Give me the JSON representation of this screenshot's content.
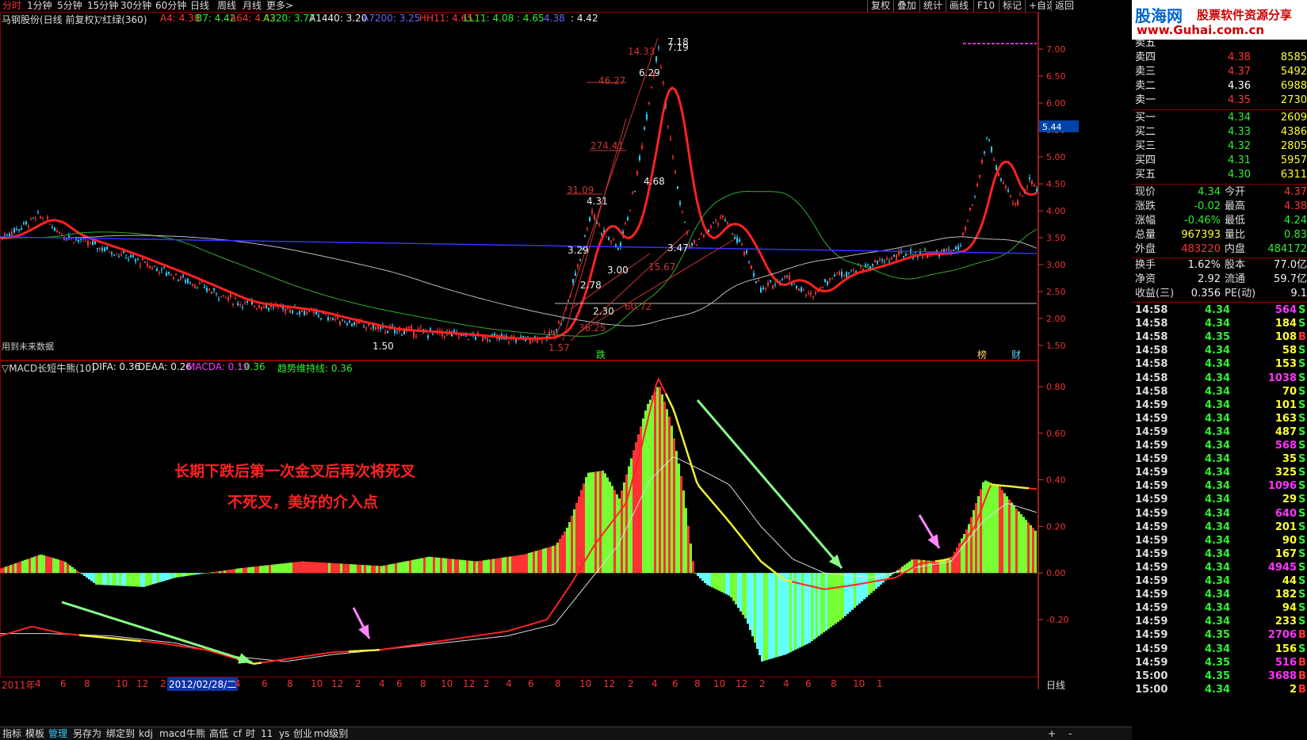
{
  "toolbar": {
    "left_items": [
      "分时",
      "1分钟",
      "5分钟",
      "15分钟",
      "30分钟",
      "60分钟",
      "日线",
      "周线",
      "月线",
      "更多>"
    ],
    "active_index": 0,
    "right_items": [
      "复权",
      "叠加",
      "统计",
      "画线",
      "F10",
      "标记",
      "+自选",
      "返回"
    ]
  },
  "main_indicator": {
    "title": "马钢股份(日线 前复权)",
    "ma_name": "▽红绿(360)",
    "items": [
      {
        "text": "A4: 4.38",
        "color": "#f33"
      },
      {
        "text": "B7: 4.42",
        "color": "#3e3"
      },
      {
        "text": "A64: 4.42",
        "color": "#f33"
      },
      {
        "text": "A320: 3.77",
        "color": "#3e3"
      },
      {
        "text": "A1440: 3.20",
        "color": "#eee"
      },
      {
        "text": "A7200: 3.25",
        "color": "#66f"
      },
      {
        "text": "HH11: 4.65",
        "color": "#f33"
      },
      {
        "text": "LL11: 4.08 : 4.65",
        "color": "#3e3"
      },
      {
        "text": "4.38",
        "color": "#66f"
      },
      {
        "text": ": 4.42",
        "color": "#eee"
      }
    ]
  },
  "sub_indicator": {
    "title": "▽MACD长短牛熊(10)",
    "items": [
      {
        "text": "DIFA: 0.36",
        "color": "#eee"
      },
      {
        "text": "DEAA: 0.26",
        "color": "#eee"
      },
      {
        "text": "MACDA: 0.19",
        "color": "#f3f"
      },
      {
        "text": ": 0.36",
        "color": "#3e3"
      },
      {
        "text": "趋势维持线: 0.36",
        "color": "#3e3"
      }
    ]
  },
  "price_axis": [
    "7.00",
    "6.50",
    "6.00",
    "5.50",
    "5.00",
    "4.50",
    "4.00",
    "3.50",
    "3.00",
    "2.50",
    "2.00",
    "1.50"
  ],
  "price_current": "5.44",
  "macd_axis": [
    "0.80",
    "0.60",
    "0.40",
    "0.20",
    "0.00",
    "-0.20"
  ],
  "price_annotations": [
    "7.18",
    "7.19",
    "14.33",
    "46.27",
    "6.29",
    "274.41",
    "31.09",
    "4.31",
    "4.68",
    "3.47",
    "3.29",
    "3.00",
    "2.78",
    "15.67",
    "60.72",
    "2.30",
    "1.50",
    "1.57",
    "36.25"
  ],
  "future_data_note": "用到未来数据",
  "marks": [
    "跌",
    "榜",
    "财"
  ],
  "annotation_line1": "长期下跌后第一次金叉后再次将死叉",
  "annotation_line2": "不死叉，美好的介入点",
  "xaxis": {
    "year": "2011年",
    "date_box": "2012/02/28/二",
    "right_label": "日线",
    "ticks": [
      "4",
      "6",
      "8",
      "10",
      "12",
      "2",
      "4",
      "6",
      "8",
      "10",
      "12",
      "2",
      "4",
      "6",
      "8",
      "10",
      "12",
      "2",
      "4",
      "6",
      "8",
      "10",
      "12",
      "2",
      "4",
      "6",
      "8",
      "10",
      "12",
      "2",
      "4",
      "6",
      "8",
      "10",
      "1"
    ]
  },
  "bottom_bar": [
    "指标",
    "模板",
    "管理",
    "另存为",
    "绑定到",
    "kdj",
    "macd",
    "牛熊",
    "高低",
    "cf",
    "时",
    "11",
    "ys",
    "创业",
    "md级别"
  ],
  "bottom_active_index": 2,
  "bottom_right": [
    "+",
    "-"
  ],
  "logo": {
    "title": "股海网",
    "subtitle": "股票软件资源分享",
    "url": "www.Guhai.com.cn"
  },
  "quote": {
    "sell": [
      {
        "label": "卖五",
        "price": "",
        "vol": ""
      },
      {
        "label": "卖四",
        "price": "4.38",
        "vol": "8585"
      },
      {
        "label": "卖三",
        "price": "4.37",
        "vol": "5492"
      },
      {
        "label": "卖二",
        "price": "4.36",
        "vol": "6988"
      },
      {
        "label": "卖一",
        "price": "4.35",
        "vol": "2730"
      }
    ],
    "buy": [
      {
        "label": "买一",
        "price": "4.34",
        "vol": "2609"
      },
      {
        "label": "买二",
        "price": "4.33",
        "vol": "4386"
      },
      {
        "label": "买三",
        "price": "4.32",
        "vol": "2805"
      },
      {
        "label": "买四",
        "price": "4.31",
        "vol": "5957"
      },
      {
        "label": "买五",
        "price": "4.30",
        "vol": "6311"
      }
    ],
    "stats": [
      {
        "l1": "现价",
        "v1": "4.34",
        "c1": "green",
        "l2": "今开",
        "v2": "4.37",
        "c2": "red"
      },
      {
        "l1": "涨跌",
        "v1": "-0.02",
        "c1": "green",
        "l2": "最高",
        "v2": "4.38",
        "c2": "red"
      },
      {
        "l1": "涨幅",
        "v1": "-0.46%",
        "c1": "green",
        "l2": "最低",
        "v2": "4.24",
        "c2": "green"
      },
      {
        "l1": "总量",
        "v1": "967393",
        "c1": "yellow",
        "l2": "量比",
        "v2": "0.83",
        "c2": "green"
      },
      {
        "l1": "外盘",
        "v1": "483220",
        "c1": "red",
        "l2": "内盘",
        "v2": "484172",
        "c2": "green"
      },
      {
        "l1": "换手",
        "v1": "1.62%",
        "c1": "white",
        "l2": "股本",
        "v2": "77.0亿",
        "c2": "white"
      },
      {
        "l1": "净资",
        "v1": "2.92",
        "c1": "white",
        "l2": "流通",
        "v2": "59.7亿",
        "c2": "white"
      },
      {
        "l1": "收益(三)",
        "v1": "0.356",
        "c1": "white",
        "l2": "PE(动)",
        "v2": "9.1",
        "c2": "white"
      }
    ],
    "ticks": [
      {
        "t": "14:58",
        "p": "4.34",
        "v": "564",
        "s": "S",
        "vc": "magenta"
      },
      {
        "t": "14:58",
        "p": "4.34",
        "v": "184",
        "s": "S",
        "vc": "yellow"
      },
      {
        "t": "14:58",
        "p": "4.35",
        "v": "108",
        "s": "B",
        "vc": "yellow"
      },
      {
        "t": "14:58",
        "p": "4.34",
        "v": "58",
        "s": "S",
        "vc": "yellow"
      },
      {
        "t": "14:58",
        "p": "4.34",
        "v": "153",
        "s": "S",
        "vc": "yellow"
      },
      {
        "t": "14:58",
        "p": "4.34",
        "v": "1038",
        "s": "S",
        "vc": "magenta"
      },
      {
        "t": "14:58",
        "p": "4.34",
        "v": "70",
        "s": "S",
        "vc": "yellow"
      },
      {
        "t": "14:59",
        "p": "4.34",
        "v": "101",
        "s": "S",
        "vc": "yellow"
      },
      {
        "t": "14:59",
        "p": "4.34",
        "v": "163",
        "s": "S",
        "vc": "yellow"
      },
      {
        "t": "14:59",
        "p": "4.34",
        "v": "487",
        "s": "S",
        "vc": "yellow"
      },
      {
        "t": "14:59",
        "p": "4.34",
        "v": "568",
        "s": "S",
        "vc": "magenta"
      },
      {
        "t": "14:59",
        "p": "4.34",
        "v": "35",
        "s": "S",
        "vc": "yellow"
      },
      {
        "t": "14:59",
        "p": "4.34",
        "v": "325",
        "s": "S",
        "vc": "yellow"
      },
      {
        "t": "14:59",
        "p": "4.34",
        "v": "1096",
        "s": "S",
        "vc": "magenta"
      },
      {
        "t": "14:59",
        "p": "4.34",
        "v": "29",
        "s": "S",
        "vc": "yellow"
      },
      {
        "t": "14:59",
        "p": "4.34",
        "v": "640",
        "s": "S",
        "vc": "magenta"
      },
      {
        "t": "14:59",
        "p": "4.34",
        "v": "201",
        "s": "S",
        "vc": "yellow"
      },
      {
        "t": "14:59",
        "p": "4.34",
        "v": "90",
        "s": "S",
        "vc": "yellow"
      },
      {
        "t": "14:59",
        "p": "4.34",
        "v": "167",
        "s": "S",
        "vc": "yellow"
      },
      {
        "t": "14:59",
        "p": "4.34",
        "v": "4945",
        "s": "S",
        "vc": "magenta"
      },
      {
        "t": "14:59",
        "p": "4.34",
        "v": "44",
        "s": "S",
        "vc": "yellow"
      },
      {
        "t": "14:59",
        "p": "4.34",
        "v": "182",
        "s": "S",
        "vc": "yellow"
      },
      {
        "t": "14:59",
        "p": "4.34",
        "v": "94",
        "s": "S",
        "vc": "yellow"
      },
      {
        "t": "14:59",
        "p": "4.34",
        "v": "233",
        "s": "S",
        "vc": "yellow"
      },
      {
        "t": "14:59",
        "p": "4.35",
        "v": "2706",
        "s": "B",
        "vc": "magenta"
      },
      {
        "t": "14:59",
        "p": "4.34",
        "v": "156",
        "s": "S",
        "vc": "yellow"
      },
      {
        "t": "14:59",
        "p": "4.35",
        "v": "516",
        "s": "B",
        "vc": "magenta"
      },
      {
        "t": "15:00",
        "p": "4.35",
        "v": "3688",
        "s": "B",
        "vc": "magenta"
      },
      {
        "t": "15:00",
        "p": "4.34",
        "v": "2",
        "s": "B",
        "vc": "yellow"
      }
    ]
  },
  "colors": {
    "up": "#f33",
    "down": "#3e3",
    "grid": "#800",
    "axis": "#e33",
    "macd_pos_red": "#f33",
    "macd_pos_green": "#7f3",
    "macd_neg_cyan": "#6ff",
    "macd_neg_green": "#7f3"
  }
}
